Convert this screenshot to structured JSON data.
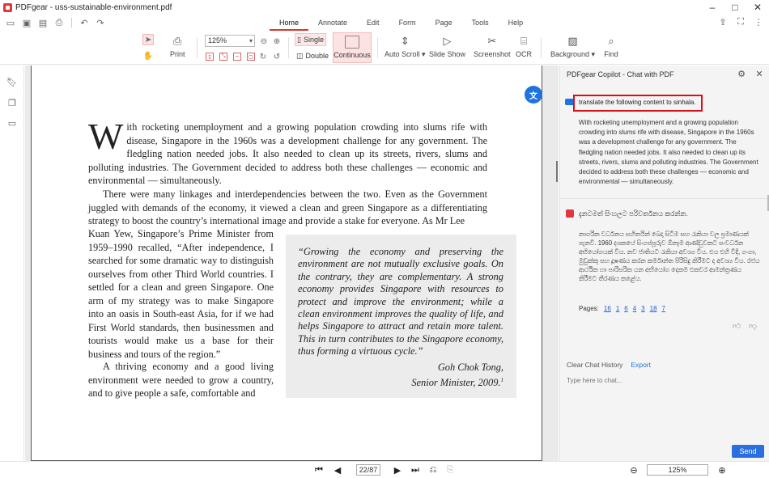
{
  "window": {
    "title": "PDFgear - uss-sustainable-environment.pdf",
    "controls": [
      "–",
      "□",
      "✕"
    ]
  },
  "menu": {
    "items": [
      "Home",
      "Annotate",
      "Edit",
      "Form",
      "Page",
      "Tools",
      "Help"
    ],
    "active": "Home"
  },
  "ribbon": {
    "print_label": "Print",
    "zoom_value": "125%",
    "single_label": "Single",
    "double_label": "Double",
    "continuous_label": "Continuous",
    "auto_scroll_label": "Auto Scroll ▾",
    "slide_show_label": "Slide Show",
    "screenshot_label": "Screenshot",
    "ocr_label": "OCR",
    "background_label": "Background ▾",
    "find_label": "Find"
  },
  "document": {
    "para1_dropcap": "W",
    "para1": "ith rocketing unemployment and a growing population crowding into slums rife with disease, Singapore in the 1960s was a development challenge for any government. The fledgling nation needed jobs. It also needed to clean up its streets, rivers, slums and polluting industries. The Government decided to address both these challenges — economic and environmental — simultaneously.",
    "para2": "There were many linkages and interdependencies between the two. Even as the Government juggled with demands of the economy, it viewed a clean and green Singapore as a differentiating strategy to boost the country’s international image and provide a stake for everyone. As Mr Lee",
    "para3": "Kuan Yew, Singapore’s Prime Minister from 1959–1990 recalled, “After independence, I searched for some dramatic way to distinguish ourselves from other Third World countries. I settled for a clean and green Singapore. One arm of my strategy was to make Singapore into an oasis in South-east Asia, for if we had First World standards, then businessmen and tourists would make us a base for their business and tours of the region.”",
    "para4": "A thriving economy and a good living environment were needed to grow a country, and to give people a safe, comfortable and",
    "quote": "“Growing the economy and preserving the environment are not mutually exclusive goals. On the contrary, they are complementary. A strong economy provides Singapore with resources to protect and improve the environment; while a clean environment improves the quality of life, and helps Singapore to attract and retain more talent. This in turn contributes to the Singapore economy, thus forming a virtuous cycle.”",
    "quote_author": "Goh Chok Tong,",
    "quote_role": "Senior Minister, 2009.",
    "quote_footnote": "1",
    "translate_badge": "文"
  },
  "navigation": {
    "page_indicator": "22/87",
    "zoom": "125%"
  },
  "copilot": {
    "title": "PDFgear Copilot - Chat with PDF",
    "user_instruction": "translate the following content to sinhala.",
    "user_text": "With rocketing unemployment and a growing population crowding into slums rife with disease, Singapore in the 1960s was a development challenge for any government. The fledgling nation needed jobs. It also needed to clean up its streets, rivers, slums and polluting industries. The Government decided to address both these challenges — economic and environmental — simultaneously.",
    "bot_intro": "දැනටමත් සිංහලට පරිවර්තනය කරන්න.",
    "bot_body": "නාගරික වර්ධනය සහිතයින් බෙදා සිටීම සහ රැකියා වල ප්‍රමාණයක් පැනවී. 1960 දශකයේ සිංගප්පූරුව ඕනෑම ආණ්ඩුවකට සංවර්ධන අභියෝගයක් විය. නව ජාතියට රැකියා අවශ්‍ය විය. එය එහි වීදි, ගංගා, මුඩුක්කු සහ දූෂණය කරන කර්මාන්ත පිරිසිදු කිරීමට ද අවශ්‍ය විය. රජය ආර්ථික හා පාරිසරික යන අභියෝග දෙකම එකවර ආමන්ත්‍රණය කිරීමට තීරණය කළේය.",
    "pages_label": "Pages:",
    "pages": [
      "16",
      "1",
      "6",
      "4",
      "3",
      "18",
      "7"
    ],
    "clear_label": "Clear Chat History",
    "export_label": "Export",
    "input_placeholder": "Type here to chat...",
    "send_label": "Send"
  }
}
